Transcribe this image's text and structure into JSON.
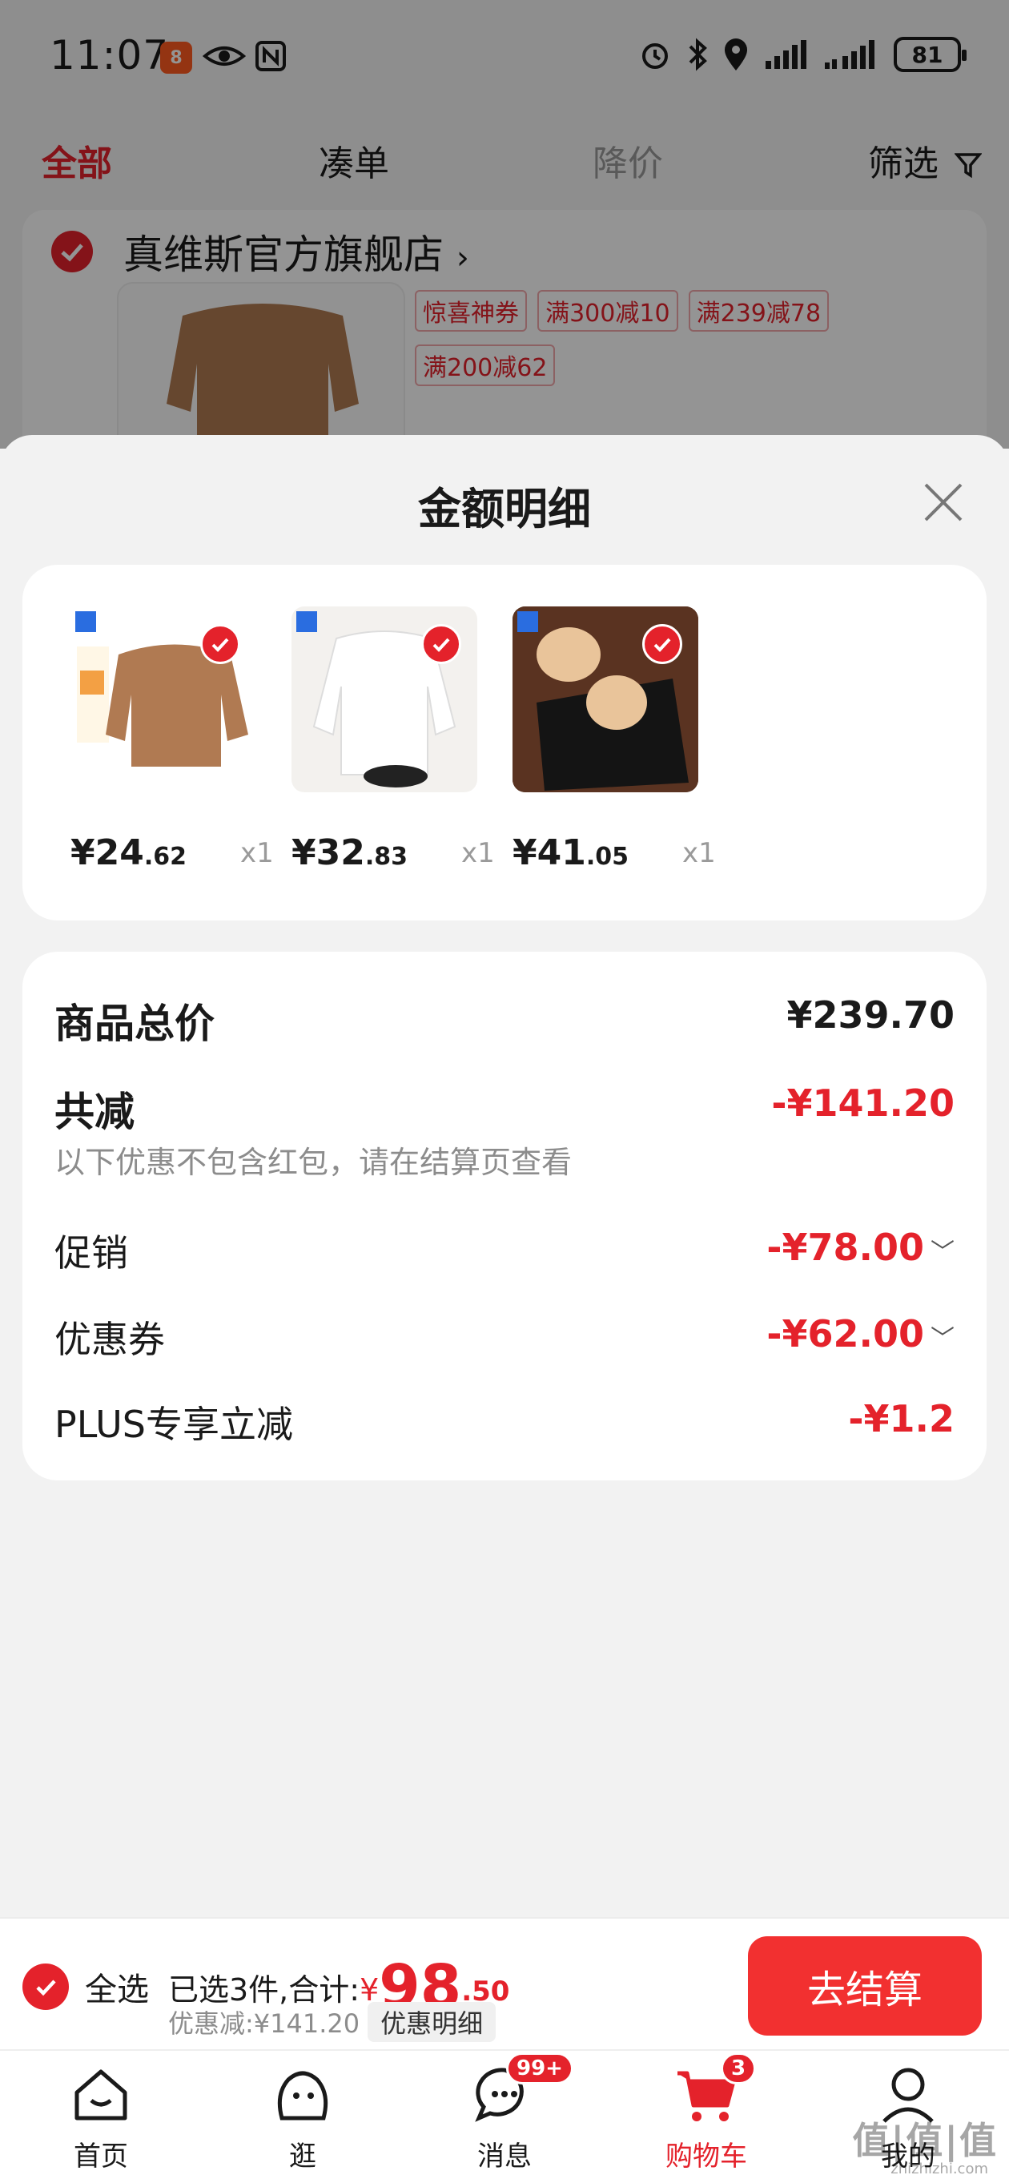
{
  "status_bar": {
    "time": "11:07",
    "app_badge": "8",
    "battery": "81"
  },
  "tabs": [
    {
      "label": "全部"
    },
    {
      "label": "凑单"
    },
    {
      "label": "降价"
    },
    {
      "label": "筛选"
    }
  ],
  "store": {
    "name": "真维斯官方旗舰店",
    "tags": [
      "惊喜神券",
      "满300减10",
      "满239减78",
      "满200减62"
    ]
  },
  "sheet": {
    "title": "金额明细",
    "products": [
      {
        "price_int": "¥24",
        "price_dec": ".62",
        "qty": "x1"
      },
      {
        "price_int": "¥32",
        "price_dec": ".83",
        "qty": "x1"
      },
      {
        "price_int": "¥41",
        "price_dec": ".05",
        "qty": "x1"
      }
    ],
    "summary": {
      "total_label": "商品总价",
      "total_value": "¥239.70",
      "reduce_label": "共减",
      "reduce_value": "-¥141.20",
      "reduce_note": "以下优惠不包含红包，请在结算页查看",
      "promo_label": "促销",
      "promo_value": "-¥78.00",
      "coupon_label": "优惠券",
      "coupon_value": "-¥62.00",
      "plus_label": "PLUS专享立减",
      "plus_value": "-¥1.2"
    }
  },
  "checkout": {
    "select_all": "全选",
    "selected_text": "已选3件,合计:",
    "total_yen": "¥",
    "total_int": "98",
    "total_dec": ".50",
    "discount_text": "优惠减:¥141.20",
    "detail_label": "优惠明细",
    "pay_label": "去结算"
  },
  "nav": [
    {
      "label": "首页"
    },
    {
      "label": "逛"
    },
    {
      "label": "消息",
      "badge": "99+"
    },
    {
      "label": "购物车",
      "badge": "3"
    },
    {
      "label": "我的"
    }
  ],
  "watermark": {
    "main": "值|值|值",
    "sub": "zhizhizhi.com"
  },
  "colors": {
    "accent": "#e4222b",
    "pay_button": "#f23030"
  }
}
